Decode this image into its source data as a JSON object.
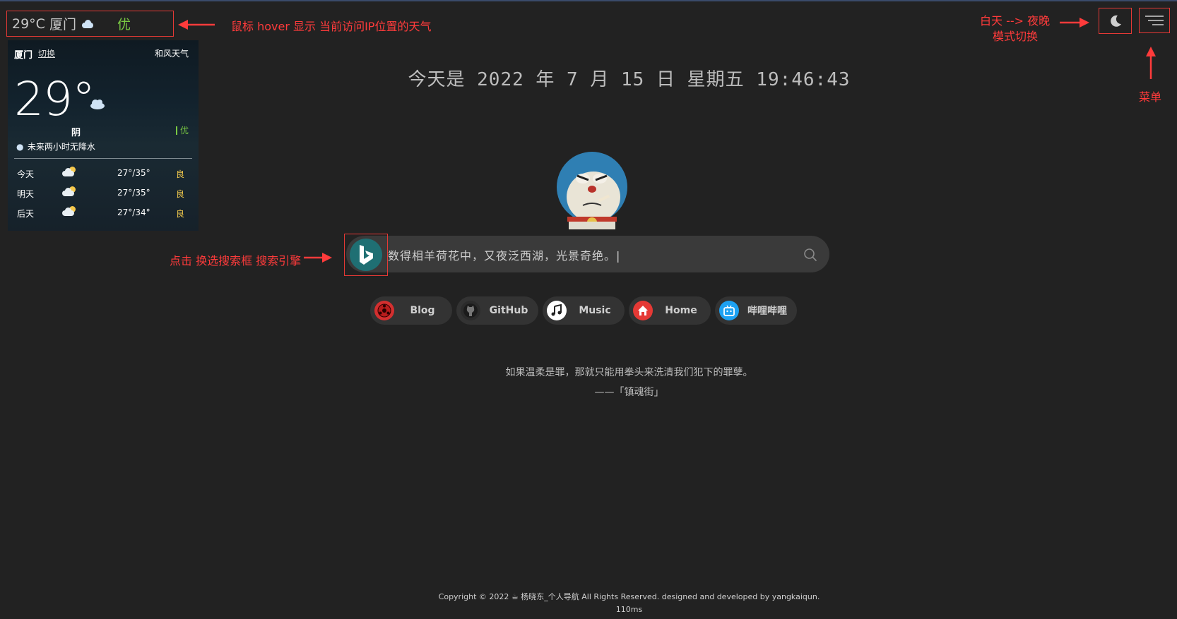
{
  "weather_chip": {
    "temp": "29°C",
    "city": "厦门",
    "aqi": "优"
  },
  "annotations": {
    "hover": "鼠标 hover  显示  当前访问IP位置的天气",
    "mode_line1": "白天 --> 夜晚",
    "mode_line2": "模式切换",
    "menu": "菜单",
    "engine": "点击  换选搜索框  搜索引擎"
  },
  "weather_card": {
    "city": "厦门",
    "switch": "切换",
    "provider": "和风天气",
    "temp": "29°",
    "condition": "阴",
    "aqi": "优",
    "rain_note": "未来两小时无降水",
    "forecast": [
      {
        "day": "今天",
        "range": "27°/35°",
        "quality": "良"
      },
      {
        "day": "明天",
        "range": "27°/35°",
        "quality": "良"
      },
      {
        "day": "后天",
        "range": "27°/34°",
        "quality": "良"
      }
    ]
  },
  "date_line": "今天是 2022 年 7 月 15 日 星期五 19:46:43",
  "search": {
    "text": "数得相羊荷花中，又夜泛西湖，光景奇绝。|",
    "engine": "bing-icon"
  },
  "links": [
    {
      "label": "Blog",
      "icon": "naruto-sharingan-icon",
      "color": "#d32f2f"
    },
    {
      "label": "GitHub",
      "icon": "github-icon",
      "color": "#2b2b2b"
    },
    {
      "label": "Music",
      "icon": "music-note-icon",
      "color": "#ffffff"
    },
    {
      "label": "Home",
      "icon": "home-icon",
      "color": "#e53935"
    },
    {
      "label": "哔哩哔哩",
      "icon": "bilibili-icon",
      "color": "#1da1f2"
    }
  ],
  "quote": "如果温柔是罪，那就只能用拳头来洗清我们犯下的罪孽。",
  "quote_source": "——「镇魂街」",
  "footer": "Copyright © 2022 ☕ 杨晓东_个人导航 All Rights Reserved. designed and developed by yangkaiqun.",
  "footer_timing": "110ms",
  "colors": {
    "background": "#222222",
    "accent_red": "#e53935",
    "aqi_green": "#7ac943"
  }
}
